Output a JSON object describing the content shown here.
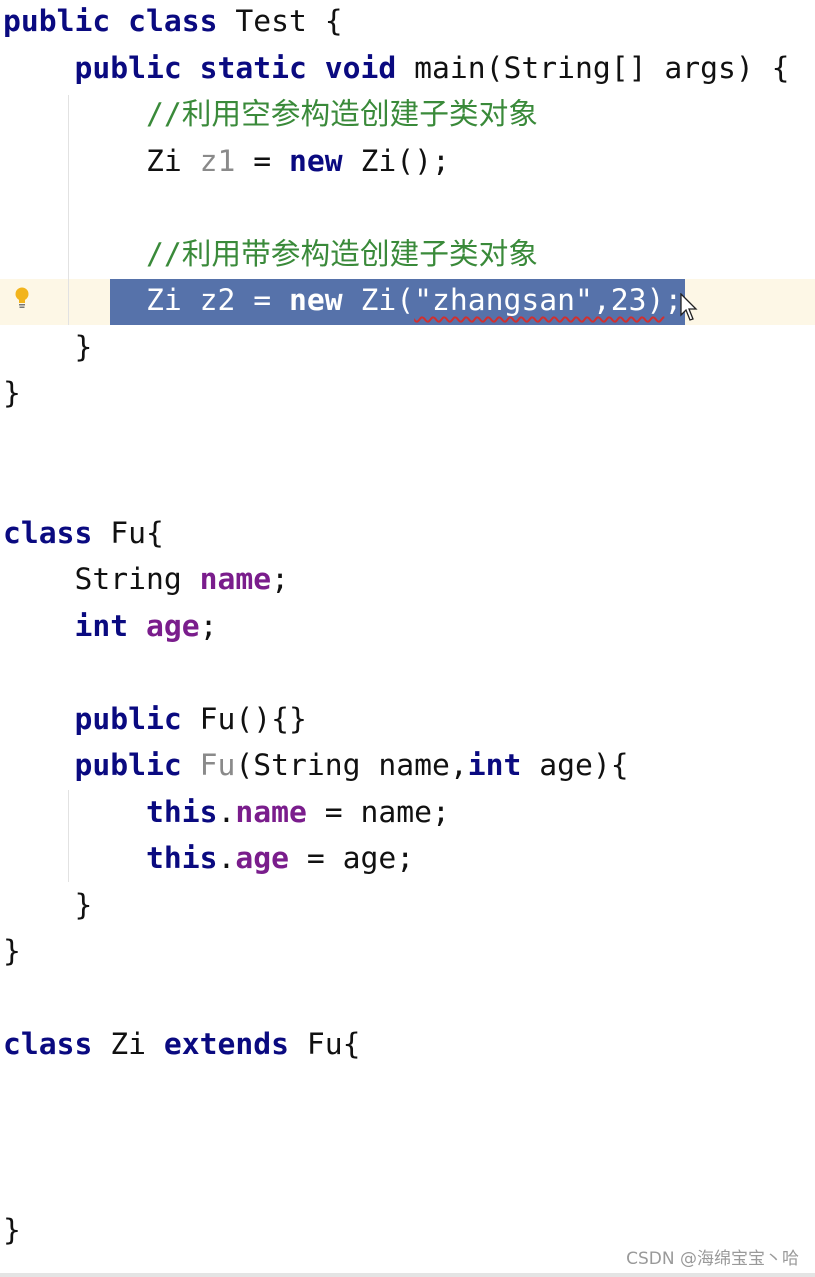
{
  "editor": {
    "highlighted_line": 6,
    "colors": {
      "keyword": "#0a0a80",
      "field": "#7a1d8c",
      "comment": "#3a8a3a",
      "unused": "#8a8a8a",
      "selection": "#5672aa",
      "caret_row": "#fdf7e6"
    },
    "lines": [
      [
        [
          "public class ",
          "kw"
        ],
        [
          "Test {",
          "plain"
        ]
      ],
      [
        [
          "    ",
          "plain"
        ],
        [
          "public static void ",
          "kw"
        ],
        [
          "main(String[] args) {",
          "plain"
        ]
      ],
      [
        [
          "        ",
          "plain"
        ],
        [
          "//利用空参构造创建子类对象",
          "comment"
        ]
      ],
      [
        [
          "        Zi ",
          "plain"
        ],
        [
          "z1",
          "unused"
        ],
        [
          " = ",
          "plain"
        ],
        [
          "new ",
          "kw"
        ],
        [
          "Zi();",
          "plain"
        ]
      ],
      [],
      [
        [
          "        ",
          "plain"
        ],
        [
          "//利用带参构造创建子类对象",
          "comment"
        ]
      ],
      [
        [
          "        ",
          "plain"
        ],
        [
          "Zi z2 = ",
          "sel"
        ],
        [
          "new ",
          "sel kw"
        ],
        [
          "Zi(",
          "sel"
        ],
        [
          "\"zhangsan\",23)",
          "sel squiggle"
        ],
        [
          ";",
          "sel"
        ]
      ],
      [
        [
          "    }",
          "plain"
        ]
      ],
      [
        [
          "}",
          "plain"
        ]
      ],
      [],
      [],
      [
        [
          "class ",
          "kw"
        ],
        [
          "Fu{",
          "plain"
        ]
      ],
      [
        [
          "    String ",
          "plain"
        ],
        [
          "name",
          "field"
        ],
        [
          ";",
          "plain"
        ]
      ],
      [
        [
          "    ",
          "plain"
        ],
        [
          "int ",
          "kw"
        ],
        [
          "age",
          "field"
        ],
        [
          ";",
          "plain"
        ]
      ],
      [],
      [
        [
          "    ",
          "plain"
        ],
        [
          "public ",
          "kw"
        ],
        [
          "Fu(){}",
          "plain"
        ]
      ],
      [
        [
          "    ",
          "plain"
        ],
        [
          "public ",
          "kw"
        ],
        [
          "Fu",
          "unused"
        ],
        [
          "(String name,",
          "plain"
        ],
        [
          "int ",
          "kw"
        ],
        [
          "age){",
          "plain"
        ]
      ],
      [
        [
          "        ",
          "plain"
        ],
        [
          "this",
          "kw"
        ],
        [
          ".",
          "plain"
        ],
        [
          "name",
          "field"
        ],
        [
          " = name;",
          "plain"
        ]
      ],
      [
        [
          "        ",
          "plain"
        ],
        [
          "this",
          "kw"
        ],
        [
          ".",
          "plain"
        ],
        [
          "age",
          "field"
        ],
        [
          " = age;",
          "plain"
        ]
      ],
      [
        [
          "    }",
          "plain"
        ]
      ],
      [
        [
          "}",
          "plain"
        ]
      ],
      [],
      [
        [
          "class ",
          "kw"
        ],
        [
          "Zi ",
          "plain"
        ],
        [
          "extends ",
          "kw"
        ],
        [
          "Fu{",
          "plain"
        ]
      ],
      [],
      [],
      [],
      [
        [
          "}",
          "plain"
        ]
      ]
    ],
    "gutter_icon": "lightbulb-icon"
  },
  "watermark": "CSDN @海绵宝宝丶哈"
}
